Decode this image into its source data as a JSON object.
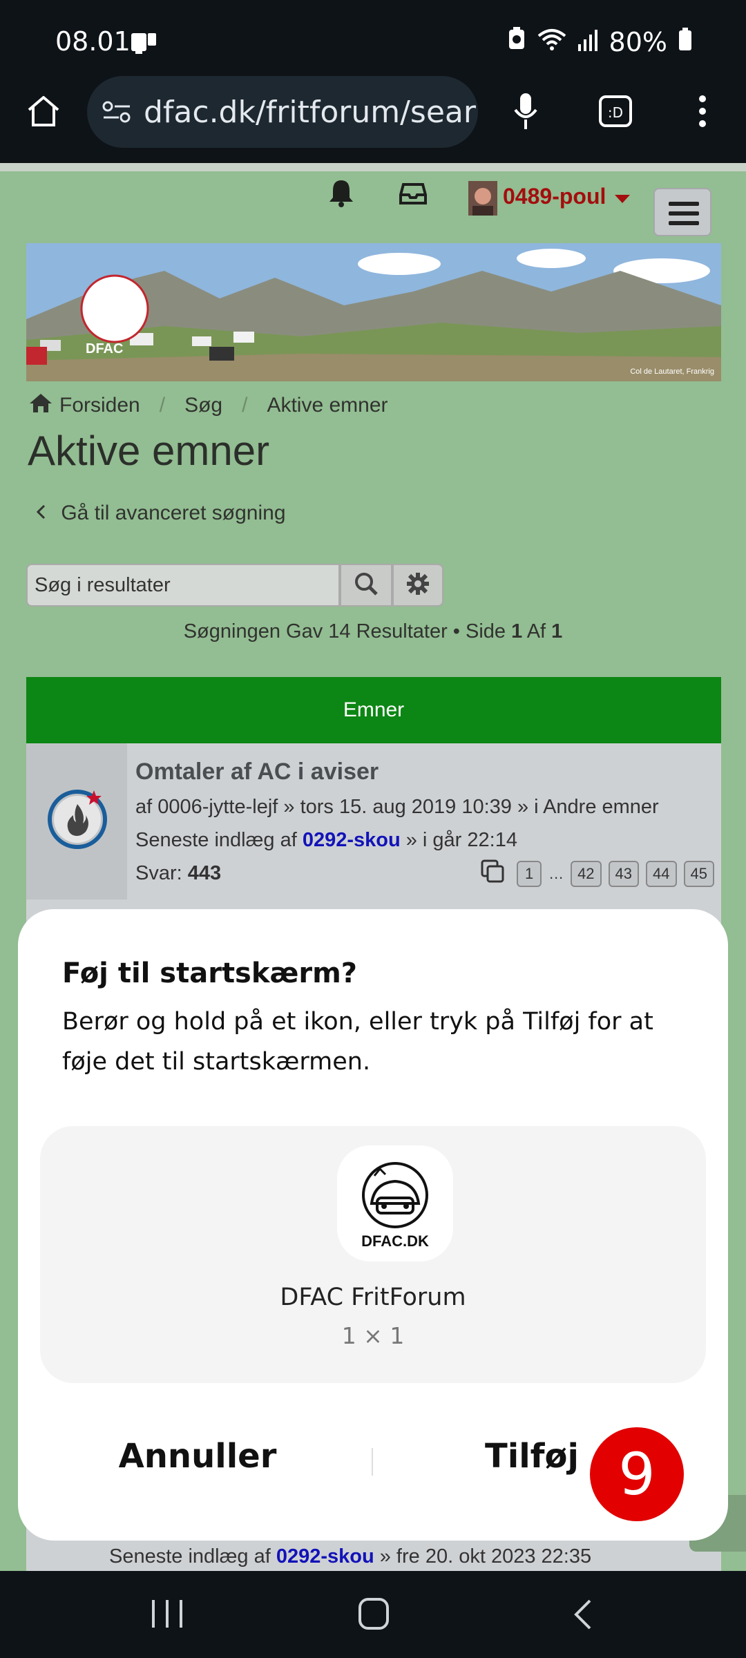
{
  "status_bar": {
    "time": "08.01",
    "battery": "80%"
  },
  "browser": {
    "url": "dfac.dk/fritforum/sear"
  },
  "forum": {
    "username": "0489-poul",
    "banner_credit": "Col de Lautaret, Frankrig",
    "banner_logo_text": "DFAC",
    "breadcrumb": [
      "Forsiden",
      "Søg",
      "Aktive emner"
    ],
    "page_title": "Aktive emner",
    "advanced_search_link": "Gå til avanceret søgning",
    "search_placeholder": "Søg i resultater",
    "result_prefix": "Søgningen Gav 14 Resultater • Side ",
    "result_page": "1",
    "result_of": " Af ",
    "result_total_pages": "1",
    "topics_header": "Emner",
    "topic": {
      "title": "Omtaler af AC i aviser",
      "meta": "af 0006-jytte-lejf » tors 15. aug 2019 10:39 » i Andre emner",
      "last_prefix": "Seneste indlæg af ",
      "last_user": "0292-skou",
      "last_time": " » i går 22:14",
      "replies_label": "Svar: ",
      "replies_count": "443",
      "pages": [
        "1",
        "…",
        "42",
        "43",
        "44",
        "45"
      ]
    },
    "bottom_topic": {
      "last_prefix": "Seneste indlæg af ",
      "last_user": "0292-skou",
      "last_time": " » fre 20. okt 2023 22:35"
    }
  },
  "dialog": {
    "title": "Føj til startskærm?",
    "description": "Berør og hold på et ikon, eller tryk på Tilføj for at føje det til startskærmen.",
    "app_name": "DFAC FritForum",
    "app_size": "1 × 1",
    "app_icon_text": "DFAC.DK",
    "cancel_label": "Annuller",
    "add_label": "Tilføj"
  },
  "badge_count": "9",
  "colors": {
    "page_bg": "#93bd92",
    "green_header": "#0c8614",
    "username": "#a30e0e",
    "link": "#1212b8",
    "badge": "#e20000"
  }
}
